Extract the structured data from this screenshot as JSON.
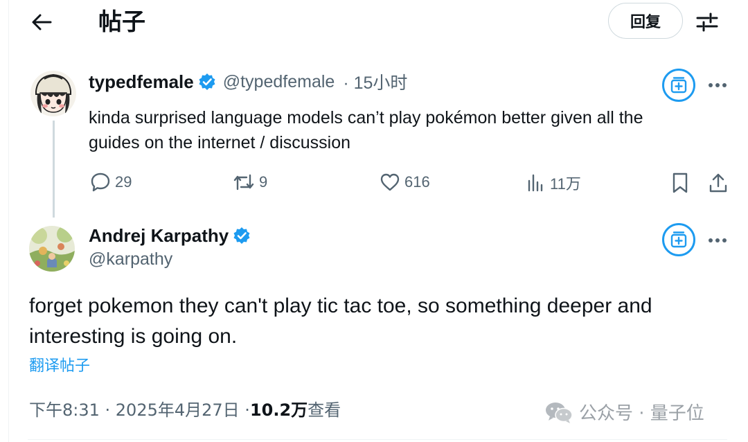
{
  "header": {
    "title": "帖子",
    "reply_label": "回复"
  },
  "parent_tweet": {
    "display_name": "typedfemale",
    "handle": "@typedfemale",
    "time": "· 15小时",
    "text_line1": "kinda surprised language models can’t play pokémon better given all the",
    "text_line2": "guides on the internet / discussion",
    "replies": "29",
    "retweets": "9",
    "likes": "616",
    "views": "11万"
  },
  "main_tweet": {
    "display_name": "Andrej Karpathy",
    "handle": "@karpathy",
    "text_line1": "forget pokemon they can't play tic tac toe, so something deeper and",
    "text_line2": "interesting is going on.",
    "translate_label": "翻译帖子",
    "timestamp": "下午8:31 · 2025年4月27日 · ",
    "views_count": "10.2万",
    "views_label": " 查看"
  },
  "watermark": {
    "text": "公众号 · 量子位"
  },
  "colors": {
    "accent": "#1d9bf0",
    "secondary_text": "#536471",
    "primary_text": "#0f1419",
    "border": "#cfd9de"
  }
}
